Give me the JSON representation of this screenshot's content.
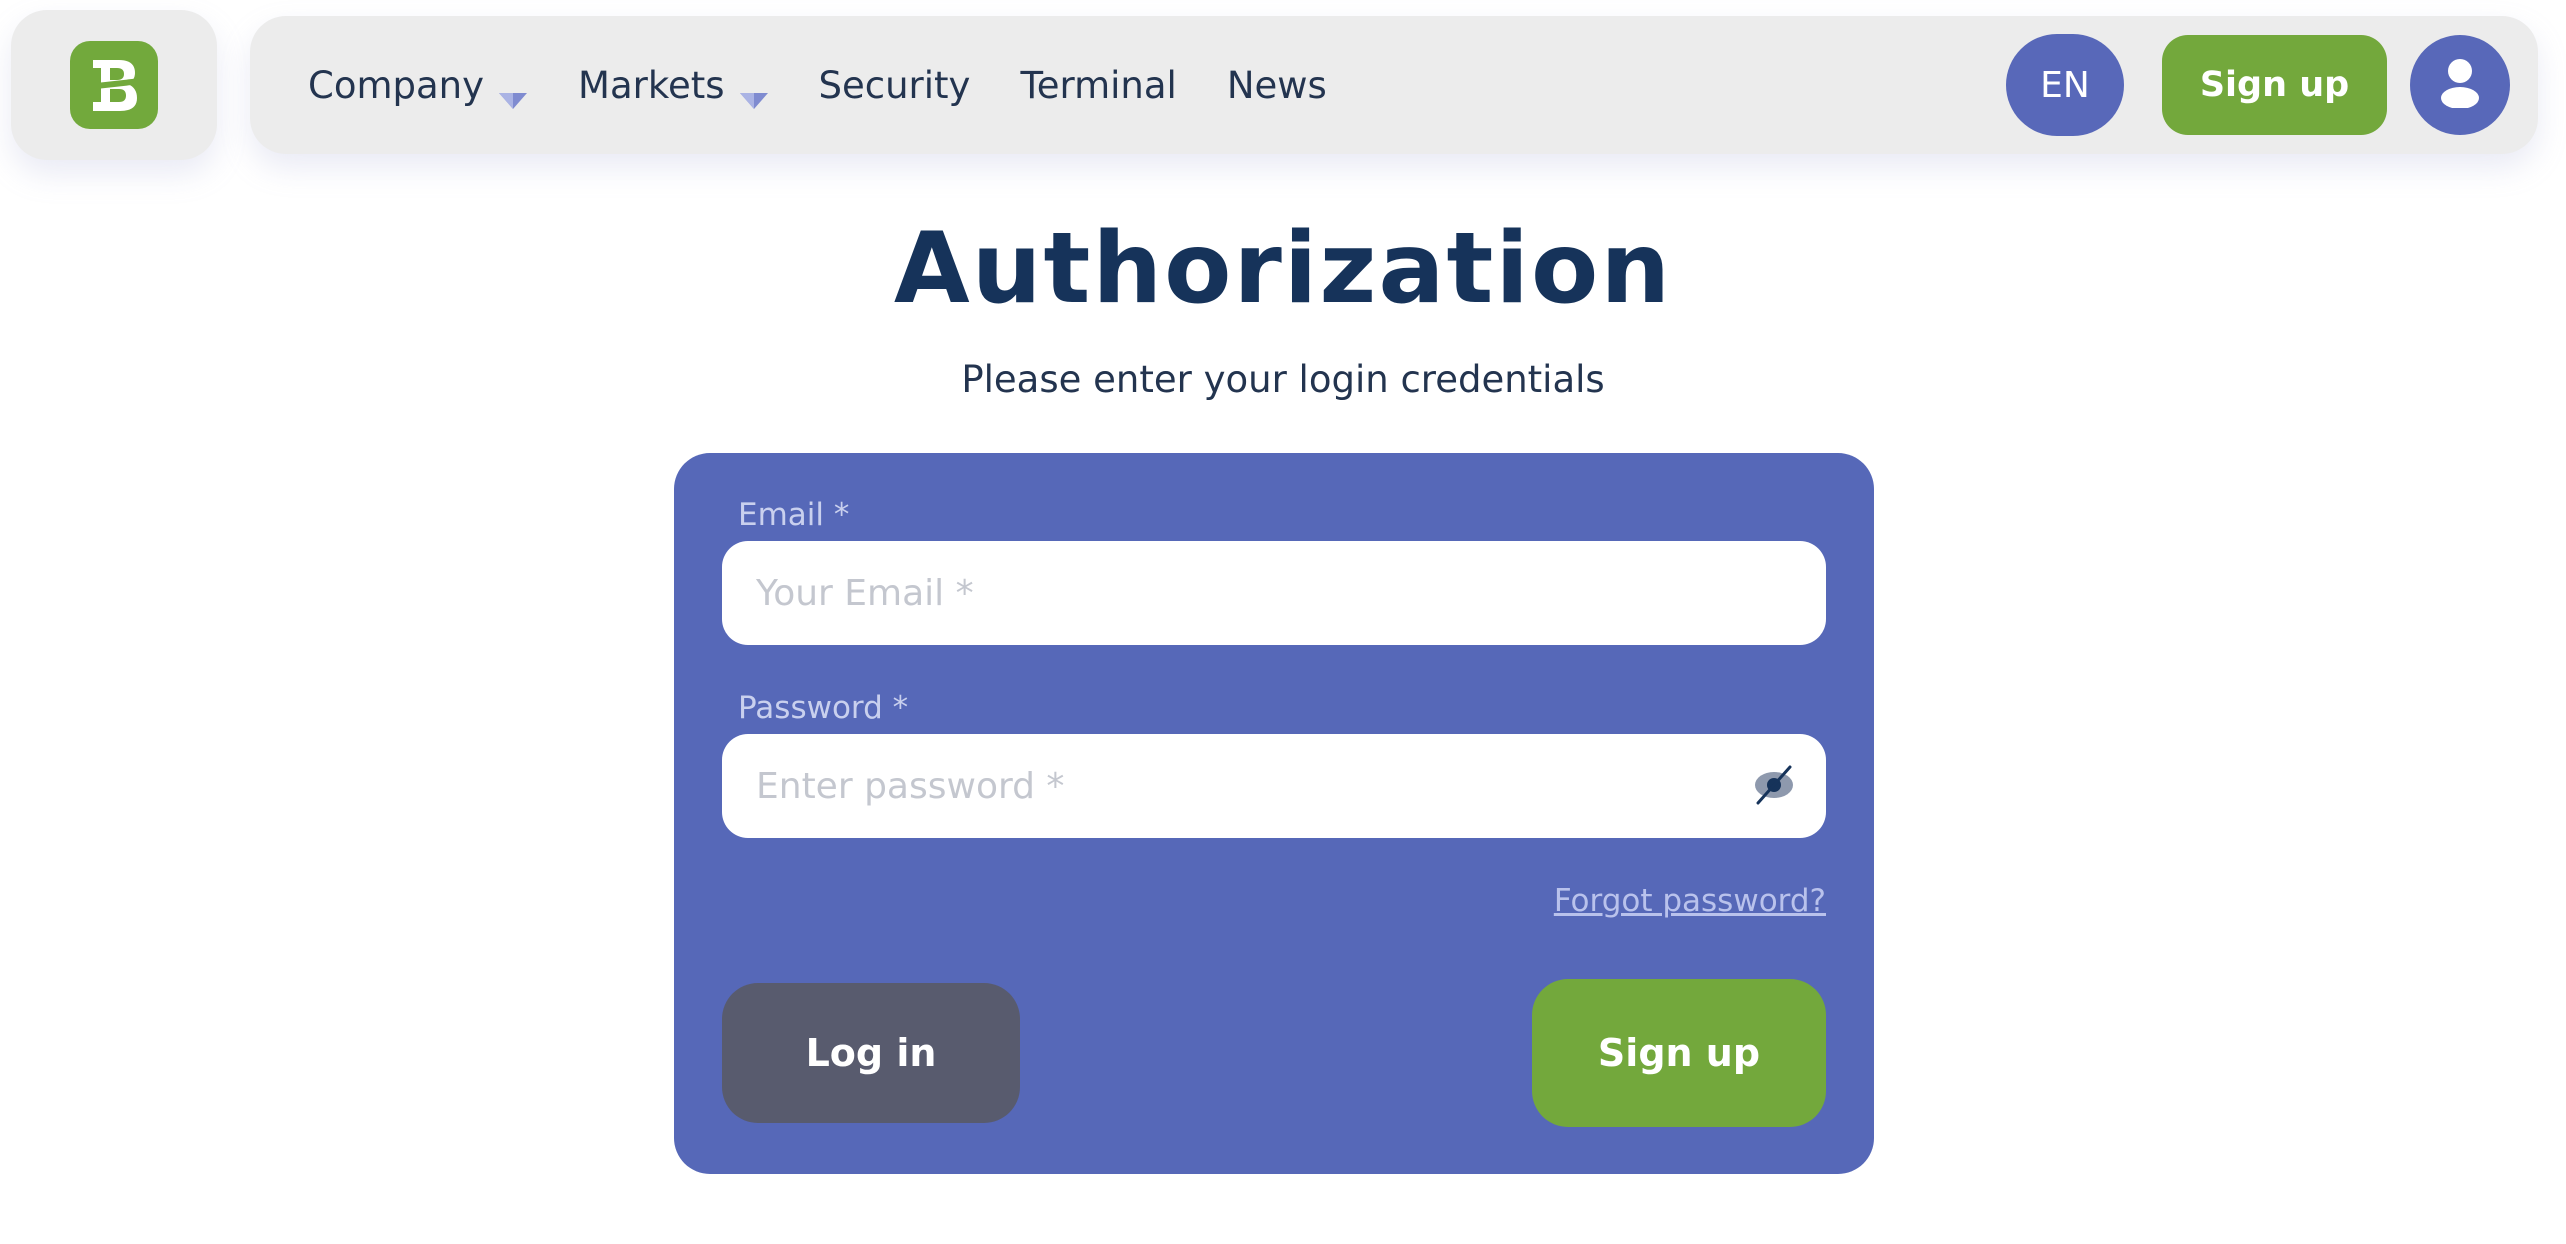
{
  "brand": {
    "logo_icon": "b-monogram-logo-icon",
    "accent_green": "#73a83c",
    "accent_blue": "#5868b9",
    "navy": "#16335a"
  },
  "nav": {
    "items": [
      {
        "label": "Company",
        "has_dropdown": true
      },
      {
        "label": "Markets",
        "has_dropdown": true
      },
      {
        "label": "Security",
        "has_dropdown": false
      },
      {
        "label": "Terminal",
        "has_dropdown": false
      },
      {
        "label": "News",
        "has_dropdown": false
      }
    ],
    "language": "EN",
    "signup_label": "Sign up",
    "account_icon": "user-icon"
  },
  "main": {
    "title": "Authorization",
    "subtitle": "Please enter your login credentials"
  },
  "form": {
    "email_label": "Email *",
    "email_placeholder": "Your Email *",
    "email_value": "",
    "password_label": "Password *",
    "password_placeholder": "Enter password *",
    "password_value": "",
    "password_toggle_icon": "eye-off-icon",
    "forgot_label": "Forgot password?",
    "login_label": "Log in",
    "signup_label": "Sign up"
  }
}
